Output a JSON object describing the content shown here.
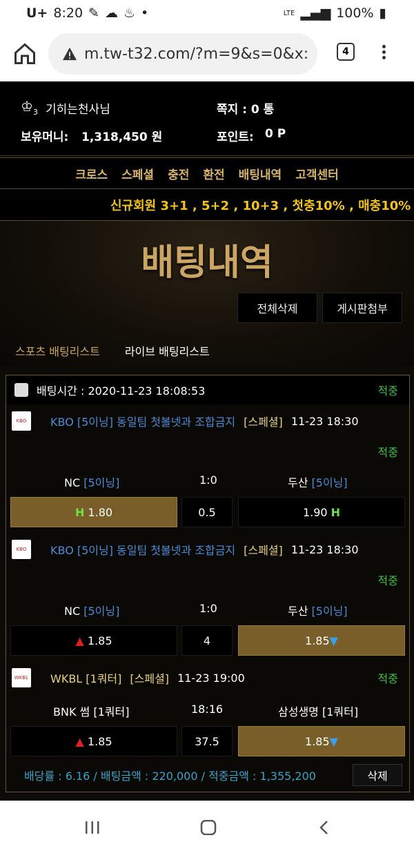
{
  "status": {
    "carrier": "U+",
    "time": "8:20",
    "battery": "100%",
    "network": "LTE"
  },
  "browser": {
    "url": "m.tw-t32.com/?m=9&s=0&x:",
    "tab_count": "4"
  },
  "user": {
    "name": "기히는천사님",
    "level": "3",
    "money_label": "보유머니:",
    "money": "1,318,450 원",
    "note_label": "쪽지 : 0 통",
    "point_label": "포인트:",
    "point": "0 P"
  },
  "nav": [
    "크로스",
    "스페셜",
    "충전",
    "환전",
    "배팅내역",
    "고객센터"
  ],
  "ticker": "신규회원 3+1 , 5+2 , 10+3 , 첫충10% , 매충10%",
  "hero": {
    "title": "배팅내역",
    "btn_delete_all": "전체삭제",
    "btn_board": "게시판첨부"
  },
  "subtabs": {
    "sports": "스포츠 배팅리스트",
    "live": "라이브 배팅리스트"
  },
  "bet": {
    "time_label": "배팅시간 : 2020-11-23 18:08:53",
    "status": "적중",
    "games": [
      {
        "league": "KBO [5이닝] 동일팀 첫볼넷과 조합금지",
        "tag": "[스페셜]",
        "time": "11-23 18:30",
        "result": "적중",
        "home": "NC",
        "home_tag": "[5이닝]",
        "score": "1:0",
        "away": "두산",
        "away_tag": "[5이닝]",
        "home_odds": "1.80",
        "mid": "0.5",
        "away_odds": "1.90"
      },
      {
        "league": "KBO [5이닝] 동일팀 첫볼넷과 조합금지",
        "tag": "[스페셜]",
        "time": "11-23 18:30",
        "result": "적중",
        "home": "NC",
        "home_tag": "[5이닝]",
        "score": "1:0",
        "away": "두산",
        "away_tag": "[5이닝]",
        "home_odds": "1.85",
        "mid": "4",
        "away_odds": "1.85"
      },
      {
        "league": "WKBL [1쿼터]",
        "tag": "[스페셜]",
        "time": "11-23 19:00",
        "result": "적중",
        "home": "BNK 썸 [1쿼터]",
        "score": "18:16",
        "away": "삼성생명 [1쿼터]",
        "home_odds": "1.85",
        "mid": "37.5",
        "away_odds": "1.85"
      }
    ],
    "summary": "배당률 : 6.16 / 배팅금액 : 220,000 / 적중금액 : 1,355,200",
    "delete": "삭제"
  },
  "logos": {
    "kbo": "KBO",
    "wkbl": "WKBL"
  },
  "colors": {
    "gold": "#c9a65c",
    "hit": "#3fbf3f",
    "selected": "#7a5e2a"
  }
}
